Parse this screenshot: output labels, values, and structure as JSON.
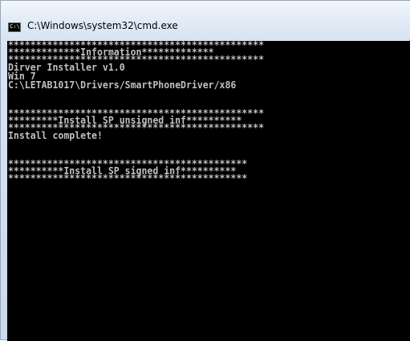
{
  "window": {
    "title": "C:\\Windows\\system32\\cmd.exe",
    "icon_text": "C:\\"
  },
  "console": {
    "block1": [
      "**********************************************",
      "*************Information*************",
      "**********************************************",
      "Dirver Installer v1.0",
      "Win 7",
      "C:\\LETAB1017\\Drivers/SmartPhoneDriver/x86"
    ],
    "block2": [
      "**********************************************",
      "*********Install SP unsigned inf**********",
      "**********************************************",
      "Install complete!"
    ],
    "block3": [
      "*******************************************",
      "**********Install SP signed inf**********",
      "*******************************************"
    ]
  }
}
